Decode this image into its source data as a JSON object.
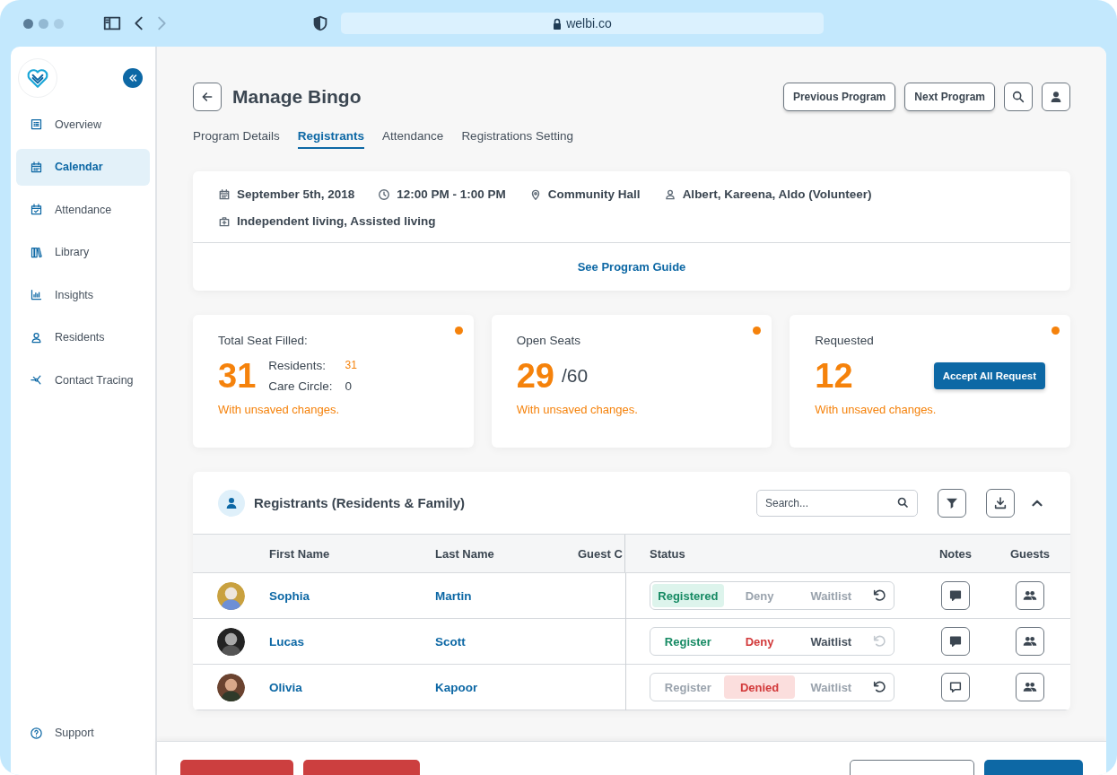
{
  "browser": {
    "url": "welbi.co"
  },
  "sidebar": {
    "items": [
      {
        "label": "Overview",
        "selected": false
      },
      {
        "label": "Calendar",
        "selected": true
      },
      {
        "label": "Attendance",
        "selected": false
      },
      {
        "label": "Library",
        "selected": false
      },
      {
        "label": "Insights",
        "selected": false
      },
      {
        "label": "Residents",
        "selected": false
      },
      {
        "label": "Contact Tracing",
        "selected": false
      }
    ],
    "footer_items": [
      {
        "label": "Support",
        "selected": false
      }
    ]
  },
  "header": {
    "title": "Manage Bingo",
    "buttons": [
      "Previous Program",
      "Next Program"
    ]
  },
  "tabs": [
    {
      "label": "Program Details",
      "selected": false
    },
    {
      "label": "Registrants",
      "selected": true
    },
    {
      "label": "Attendance",
      "selected": false
    },
    {
      "label": "Registrations Setting",
      "selected": false
    }
  ],
  "program_info": {
    "details": [
      {
        "text": "September 5th, 2018"
      },
      {
        "text": "12:00 PM - 1:00 PM"
      },
      {
        "text": "Community Hall"
      },
      {
        "text": "Albert, Kareena, Aldo (Volunteer)"
      },
      {
        "text": "Independent living, Assisted living"
      }
    ],
    "guide_link": "See Program Guide"
  },
  "stats": [
    {
      "label": "Total Seat Filled:",
      "value": "31",
      "breakdown": [
        {
          "label": "Residents:",
          "value": "31",
          "highlight": true
        },
        {
          "label": "Care Circle:",
          "value": "0",
          "highlight": false
        }
      ],
      "note": "With unsaved changes.",
      "unsaved": true
    },
    {
      "label": "Open Seats",
      "value": "29",
      "total": "/60",
      "note": "With unsaved changes.",
      "unsaved": true
    },
    {
      "label": "Requested",
      "value": "12",
      "action": "Accept All Request",
      "note": "With unsaved changes.",
      "unsaved": true
    }
  ],
  "registrants": {
    "title": "Registrants (Residents & Family)",
    "search": {
      "placeholder": "Search..."
    },
    "columns": [
      "First Name",
      "Last Name",
      "Guest C",
      "Status",
      "Notes",
      "Guests"
    ],
    "rows": [
      {
        "photo": {
          "kind": "picture"
        },
        "first_name": "Sophia",
        "last_name": "Martin",
        "status": [
          {
            "kind": "register",
            "label": "Registered",
            "selected": true
          },
          {
            "kind": "deny",
            "label": "Deny",
            "selected": false
          },
          {
            "kind": "waitlist",
            "label": "Waitlist",
            "selected": false
          }
        ],
        "undo_enabled": true,
        "has_notes": true
      },
      {
        "photo": {
          "kind": "picture"
        },
        "first_name": "Lucas",
        "last_name": "Scott",
        "status": [
          {
            "kind": "register",
            "label": "Register",
            "selected": false
          },
          {
            "kind": "deny",
            "label": "Deny",
            "selected": false
          },
          {
            "kind": "waitlist",
            "label": "Waitlist",
            "selected": false
          }
        ],
        "undo_enabled": false,
        "has_notes": true
      },
      {
        "photo": {
          "kind": "picture"
        },
        "first_name": "Olivia",
        "last_name": "Kapoor",
        "status": [
          {
            "kind": "register",
            "label": "Register",
            "selected": false
          },
          {
            "kind": "deny",
            "label": "Denied",
            "selected": true
          },
          {
            "kind": "waitlist",
            "label": "Waitlist",
            "selected": false
          }
        ],
        "undo_enabled": true,
        "has_notes": false
      }
    ]
  }
}
